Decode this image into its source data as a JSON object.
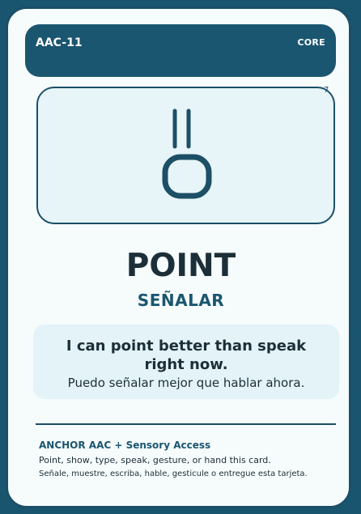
{
  "card": {
    "id": "AAC-11",
    "category": "CORE",
    "symbol_icon": "point-icon",
    "word_en": "POINT",
    "word_es": "SEÑALAR",
    "sentence_en": "I can point better than speak right now.",
    "sentence_es": "Puedo señalar mejor que hablar ahora.",
    "corner_mark": "7"
  },
  "footer": {
    "title": "ANCHOR AAC + Sensory Access",
    "instruction_en": "Point, show, type, speak, gesture, or hand this card.",
    "instruction_es": "Señale, muestre, escriba, hable, gesticule o entregue esta tarjeta."
  },
  "colors": {
    "frame": "#1b4f67",
    "header": "#1b5670",
    "card_bg": "#f6fbfc",
    "symbol_bg": "#e7f5f8",
    "sentence_bg": "#e3f3f7",
    "text_dark": "#1c2f38"
  }
}
